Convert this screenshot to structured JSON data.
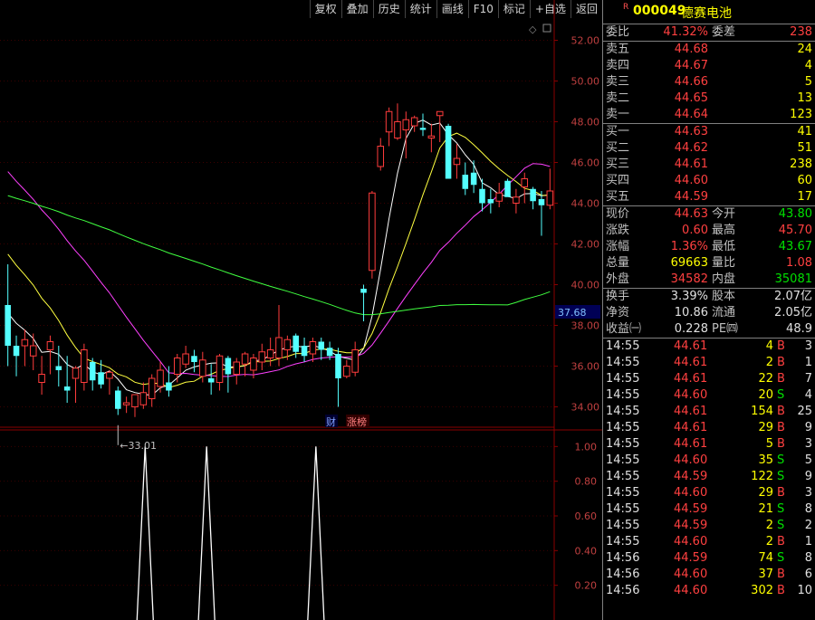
{
  "toolbar": [
    "复权",
    "叠加",
    "历史",
    "统计",
    "画线",
    "F10",
    "标记",
    "+自选",
    "返回"
  ],
  "header": {
    "flag": "R",
    "code": "000049",
    "name": "德赛电池"
  },
  "weibi": {
    "label": "委比",
    "value": "41.32%",
    "label2": "委差",
    "value2": "238"
  },
  "sell": [
    {
      "label": "卖五",
      "price": "44.68",
      "vol": "24"
    },
    {
      "label": "卖四",
      "price": "44.67",
      "vol": "4"
    },
    {
      "label": "卖三",
      "price": "44.66",
      "vol": "5"
    },
    {
      "label": "卖二",
      "price": "44.65",
      "vol": "13"
    },
    {
      "label": "卖一",
      "price": "44.64",
      "vol": "123"
    }
  ],
  "buy": [
    {
      "label": "买一",
      "price": "44.63",
      "vol": "41"
    },
    {
      "label": "买二",
      "price": "44.62",
      "vol": "51"
    },
    {
      "label": "买三",
      "price": "44.61",
      "vol": "238"
    },
    {
      "label": "买四",
      "price": "44.60",
      "vol": "60"
    },
    {
      "label": "买五",
      "price": "44.59",
      "vol": "17"
    }
  ],
  "quote": [
    {
      "l1": "现价",
      "v1": "44.63",
      "c1": "red",
      "l2": "今开",
      "v2": "43.80",
      "c2": "grn"
    },
    {
      "l1": "涨跌",
      "v1": "0.60",
      "c1": "red",
      "l2": "最高",
      "v2": "45.70",
      "c2": "red"
    },
    {
      "l1": "涨幅",
      "v1": "1.36%",
      "c1": "red",
      "l2": "最低",
      "v2": "43.67",
      "c2": "grn"
    },
    {
      "l1": "总量",
      "v1": "69663",
      "c1": "yel",
      "l2": "量比",
      "v2": "1.08",
      "c2": "red"
    },
    {
      "l1": "外盘",
      "v1": "34582",
      "c1": "red",
      "l2": "内盘",
      "v2": "35081",
      "c2": "grn"
    }
  ],
  "stats": [
    {
      "l1": "换手",
      "v1": "3.39%",
      "l2": "股本",
      "v2": "2.07亿"
    },
    {
      "l1": "净资",
      "v1": "10.86",
      "l2": "流通",
      "v2": "2.05亿"
    },
    {
      "l1": "收益㈠",
      "v1": "0.228",
      "l2": "PE㈣",
      "v2": "48.9"
    }
  ],
  "trades": [
    {
      "t": "14:55",
      "p": "44.61",
      "q": "4",
      "d": "B",
      "n": "3"
    },
    {
      "t": "14:55",
      "p": "44.61",
      "q": "2",
      "d": "B",
      "n": "1"
    },
    {
      "t": "14:55",
      "p": "44.61",
      "q": "22",
      "d": "B",
      "n": "7"
    },
    {
      "t": "14:55",
      "p": "44.60",
      "q": "20",
      "d": "S",
      "n": "4"
    },
    {
      "t": "14:55",
      "p": "44.61",
      "q": "154",
      "d": "B",
      "n": "25"
    },
    {
      "t": "14:55",
      "p": "44.61",
      "q": "29",
      "d": "B",
      "n": "9"
    },
    {
      "t": "14:55",
      "p": "44.61",
      "q": "5",
      "d": "B",
      "n": "3"
    },
    {
      "t": "14:55",
      "p": "44.60",
      "q": "35",
      "d": "S",
      "n": "5"
    },
    {
      "t": "14:55",
      "p": "44.59",
      "q": "122",
      "d": "S",
      "n": "9"
    },
    {
      "t": "14:55",
      "p": "44.60",
      "q": "29",
      "d": "B",
      "n": "3"
    },
    {
      "t": "14:55",
      "p": "44.59",
      "q": "21",
      "d": "S",
      "n": "8"
    },
    {
      "t": "14:55",
      "p": "44.59",
      "q": "2",
      "d": "S",
      "n": "2"
    },
    {
      "t": "14:55",
      "p": "44.60",
      "q": "2",
      "d": "B",
      "n": "1"
    },
    {
      "t": "14:56",
      "p": "44.59",
      "q": "74",
      "d": "S",
      "n": "8"
    },
    {
      "t": "14:56",
      "p": "44.60",
      "q": "37",
      "d": "B",
      "n": "6"
    },
    {
      "t": "14:56",
      "p": "44.60",
      "q": "302",
      "d": "B",
      "n": "10"
    }
  ],
  "chart_data": [
    {
      "type": "candlestick",
      "y_ticks": [
        "52.00",
        "50.00",
        "48.00",
        "46.00",
        "44.00",
        "42.00",
        "40.00",
        "38.00",
        "36.00",
        "34.00"
      ],
      "ylim": [
        33,
        53
      ],
      "current_price_label": "37.68",
      "low_annotation": "33.01",
      "markers": [
        "财",
        "涨榜"
      ],
      "candles": [
        [
          39,
          41,
          36,
          37
        ],
        [
          37,
          37.5,
          35.5,
          36.5
        ],
        [
          37,
          37.8,
          36,
          37.3
        ],
        [
          36.5,
          37.6,
          35.8,
          37
        ],
        [
          35.2,
          36.5,
          34.6,
          35.6
        ],
        [
          36.8,
          37.5,
          35.6,
          37.2
        ],
        [
          36,
          37,
          35,
          35.8
        ],
        [
          35,
          36.5,
          34.2,
          34.8
        ],
        [
          35.4,
          36,
          34.2,
          35.9
        ],
        [
          35.2,
          37.1,
          34.8,
          36.8
        ],
        [
          36.2,
          36.4,
          34.8,
          35.3
        ],
        [
          35.7,
          36.3,
          34.9,
          35.1
        ],
        [
          35.4,
          35.8,
          34.6,
          35.7
        ],
        [
          34.8,
          35,
          33.6,
          33.9
        ],
        [
          34.1,
          34.5,
          33.7,
          34.2
        ],
        [
          34,
          34.6,
          33.5,
          34.6
        ],
        [
          34.1,
          35.2,
          33.9,
          34.7
        ],
        [
          34.4,
          35.6,
          34,
          35.4
        ],
        [
          35,
          36.2,
          34.7,
          35.8
        ],
        [
          35.2,
          36,
          34.5,
          34.8
        ],
        [
          35.6,
          36.6,
          35.2,
          36.4
        ],
        [
          36.1,
          37,
          35.9,
          36.6
        ],
        [
          36.5,
          36.8,
          35.7,
          36.2
        ],
        [
          35.5,
          36.7,
          35.2,
          36.3
        ],
        [
          35.4,
          36.1,
          34.6,
          35.2
        ],
        [
          35.2,
          36.6,
          34.8,
          36.5
        ],
        [
          36.4,
          36.5,
          34.7,
          35.6
        ],
        [
          35.6,
          36.4,
          35.1,
          36.2
        ],
        [
          36.1,
          36.7,
          35.5,
          36.6
        ],
        [
          35.8,
          36.6,
          35.4,
          36.4
        ],
        [
          36.2,
          37.1,
          35.8,
          36.7
        ],
        [
          36.4,
          37.4,
          36,
          36.8
        ],
        [
          36.4,
          39,
          36,
          37.4
        ],
        [
          36.8,
          37.5,
          36.3,
          37.3
        ],
        [
          37.5,
          37.6,
          36.4,
          36.7
        ],
        [
          37,
          37.4,
          36.2,
          36.5
        ],
        [
          36.6,
          37.4,
          36.2,
          37.2
        ],
        [
          37.2,
          37.4,
          36.3,
          36.8
        ],
        [
          36.9,
          37.2,
          36.3,
          36.5
        ],
        [
          36.6,
          36.9,
          34,
          35.4
        ],
        [
          35.5,
          36.3,
          35.4,
          36
        ],
        [
          35.7,
          37.2,
          35.5,
          36.8
        ],
        [
          39.8,
          40,
          38.2,
          39.6
        ],
        [
          40.7,
          44.6,
          40.3,
          44.5
        ],
        [
          45.8,
          47.2,
          45.6,
          46.8
        ],
        [
          47.5,
          48.7,
          46.8,
          48.5
        ],
        [
          47.2,
          48.9,
          47.1,
          48
        ],
        [
          47.6,
          48.5,
          46.2,
          48.1
        ],
        [
          47.8,
          48.3,
          47.5,
          48.2
        ],
        [
          47.7,
          48.4,
          47.3,
          47.6
        ],
        [
          47.2,
          47.9,
          46.5,
          47.3
        ],
        [
          48.3,
          48.5,
          47,
          48.5
        ],
        [
          47.8,
          47.9,
          45.4,
          45.2
        ],
        [
          45.9,
          46.9,
          45.2,
          46.2
        ],
        [
          45.4,
          46,
          44.4,
          44.7
        ],
        [
          45.5,
          46.1,
          44.5,
          44.9
        ],
        [
          44.7,
          45.2,
          43.6,
          44
        ],
        [
          44.2,
          44.7,
          43.5,
          44
        ],
        [
          44.1,
          45,
          43.8,
          44.5
        ],
        [
          45.1,
          45.2,
          44.4,
          44.3
        ],
        [
          44,
          44.7,
          43.5,
          44.3
        ],
        [
          44.8,
          45.5,
          44,
          45.2
        ],
        [
          44.7,
          44.8,
          43.7,
          44.1
        ],
        [
          44.2,
          44.6,
          42.4,
          43.9
        ],
        [
          43.9,
          45.7,
          43.7,
          44.6
        ]
      ],
      "indicator": {
        "y_ticks": [
          "1.00",
          "0.80",
          "0.60",
          "0.40",
          "0.20"
        ],
        "ylim": [
          0,
          1.08
        ],
        "spikes_at": [
          13,
          20,
          33
        ]
      }
    }
  ]
}
